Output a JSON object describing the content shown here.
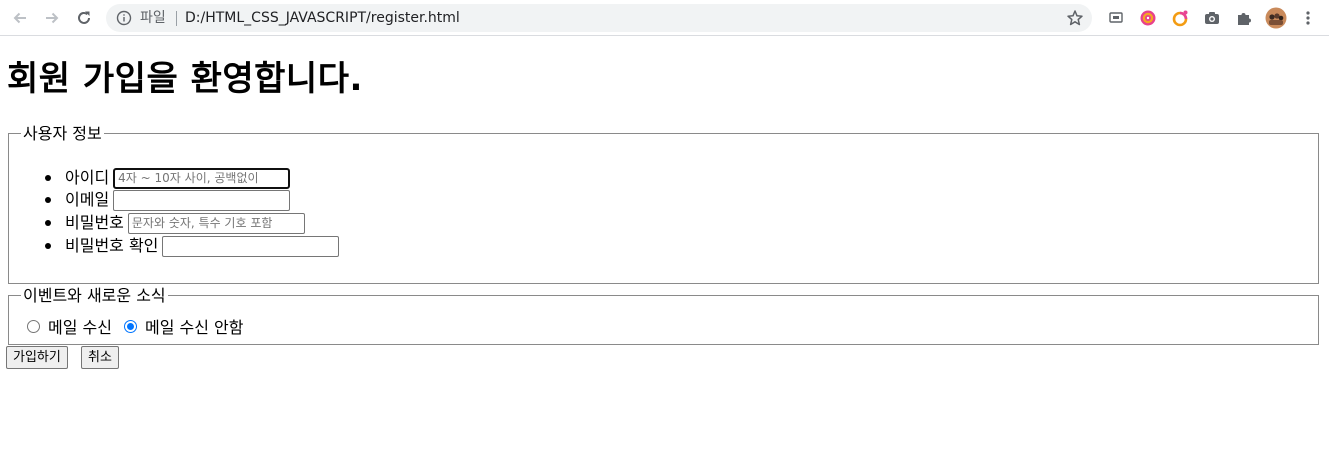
{
  "browser": {
    "url_scheme_label": "파일",
    "url": "D:/HTML_CSS_JAVASCRIPT/register.html",
    "extensions": [
      "media-router-icon",
      "target-extension-icon",
      "ring-extension-icon",
      "camera-icon",
      "puzzle-icon"
    ],
    "accent_color": "#1a73e8"
  },
  "page": {
    "heading": "회원 가입을 환영합니다.",
    "user_info": {
      "legend": "사용자 정보",
      "fields": [
        {
          "label": "아이디",
          "placeholder": "4자 ~ 10자 사이, 공백없이",
          "value": ""
        },
        {
          "label": "이메일",
          "placeholder": "",
          "value": ""
        },
        {
          "label": "비밀번호",
          "placeholder": "문자와 숫자, 특수 기호 포함",
          "value": ""
        },
        {
          "label": "비밀번호 확인",
          "placeholder": "",
          "value": ""
        }
      ]
    },
    "newsletter": {
      "legend": "이벤트와 새로운 소식",
      "options": [
        {
          "label": "메일 수신",
          "checked": false
        },
        {
          "label": "메일 수신 안함",
          "checked": true
        }
      ]
    },
    "buttons": {
      "submit": "가입하기",
      "cancel": "취소"
    }
  }
}
